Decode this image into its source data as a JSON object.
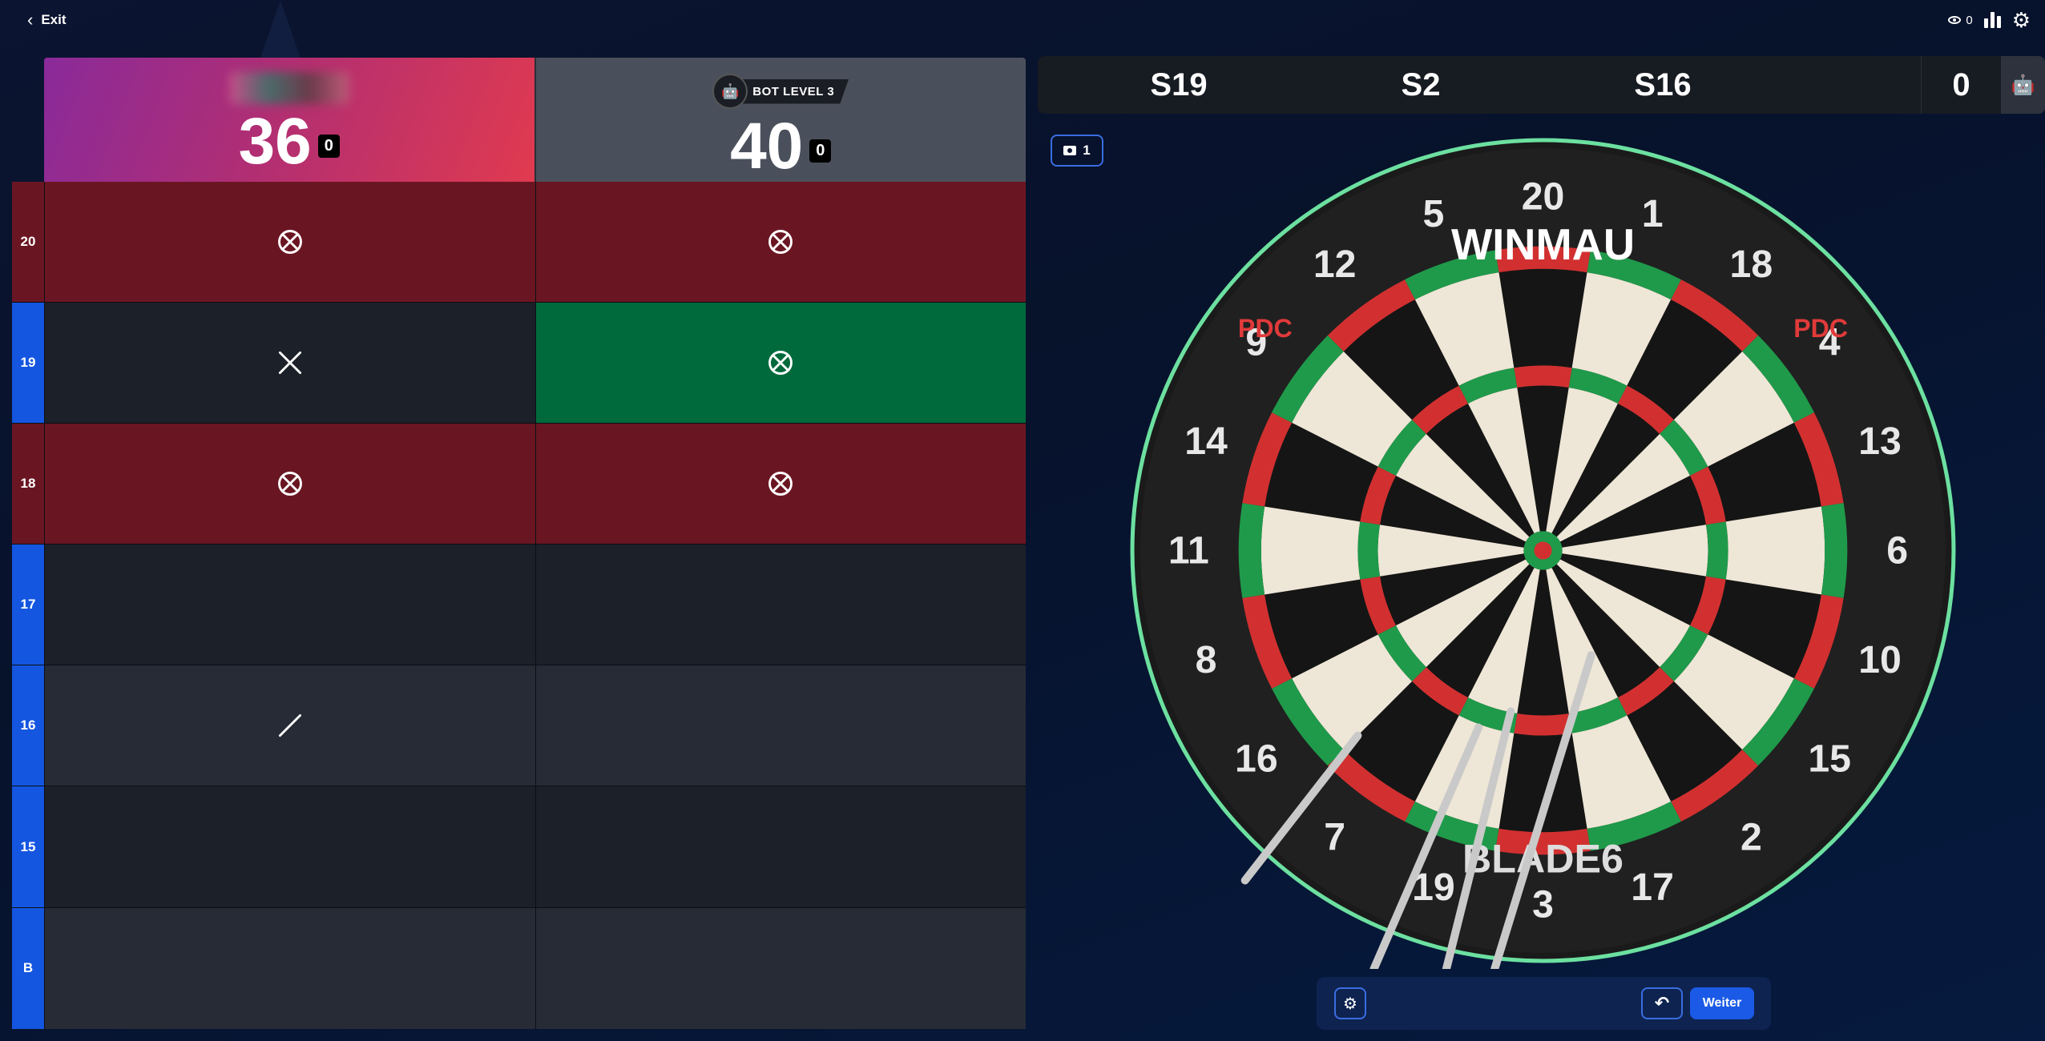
{
  "topbar": {
    "exit_label": "Exit",
    "viewers_count": "0"
  },
  "players": [
    {
      "name": "",
      "name_hidden": true,
      "score": "36",
      "legs": "0"
    },
    {
      "name": "BOT LEVEL 3",
      "score": "40",
      "legs": "0"
    }
  ],
  "grid": {
    "rows": [
      {
        "label": "20",
        "closed": true,
        "marks": [
          "circle-x",
          "circle-x"
        ]
      },
      {
        "label": "19",
        "closed": false,
        "marks": [
          "x",
          "circle-x"
        ]
      },
      {
        "label": "18",
        "closed": true,
        "marks": [
          "circle-x",
          "circle-x"
        ]
      },
      {
        "label": "17",
        "closed": false,
        "marks": [
          "",
          ""
        ]
      },
      {
        "label": "16",
        "closed": false,
        "marks": [
          "slash",
          ""
        ]
      },
      {
        "label": "15",
        "closed": false,
        "marks": [
          "",
          ""
        ]
      },
      {
        "label": "B",
        "closed": false,
        "marks": [
          "",
          ""
        ]
      }
    ]
  },
  "throws": {
    "items": [
      "S19",
      "S2",
      "S16"
    ],
    "total": "0"
  },
  "camera": {
    "count": "1"
  },
  "dartboard": {
    "brand_top": "WINMAU",
    "brand_bottom": "BLADE6",
    "badge": "PDC",
    "numbers": [
      "20",
      "1",
      "18",
      "4",
      "13",
      "6",
      "10",
      "15",
      "2",
      "17",
      "3",
      "19",
      "7",
      "16",
      "8",
      "11",
      "14",
      "9",
      "12",
      "5"
    ]
  },
  "controls": {
    "next_label": "Weiter"
  },
  "colors": {
    "accent": "#1a5ae6",
    "closed": "#6a1622",
    "hit": "#006a3c",
    "row_label": "#1456e0"
  }
}
